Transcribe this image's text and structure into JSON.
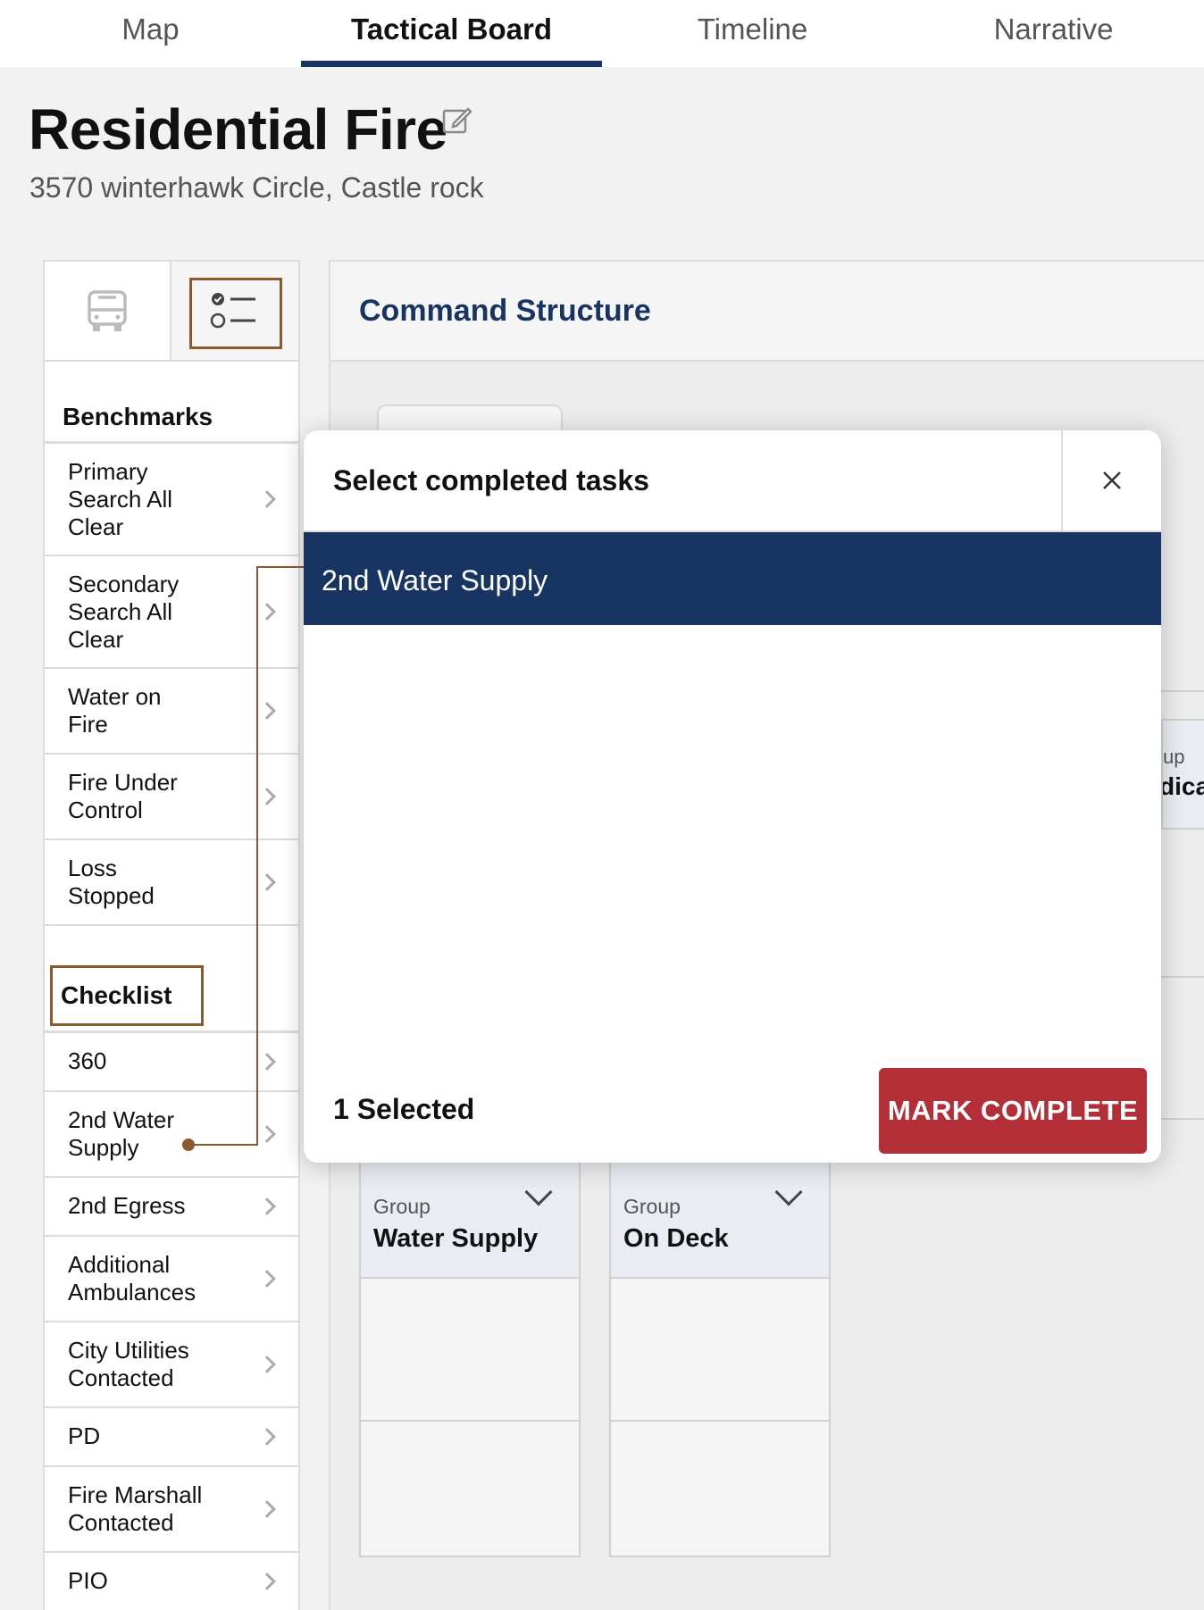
{
  "tabs": [
    {
      "label": "Map"
    },
    {
      "label": "Tactical Board"
    },
    {
      "label": "Timeline"
    },
    {
      "label": "Narrative"
    }
  ],
  "active_tab": "Tactical Board",
  "header": {
    "title": "Residential Fire",
    "address": "3570 winterhawk Circle, Castle rock"
  },
  "sidebar": {
    "benchmarks_title": "Benchmarks",
    "benchmarks": [
      {
        "label": "Primary\nSearch All\nClear"
      },
      {
        "label": "Secondary\nSearch All\nClear"
      },
      {
        "label": "Water on\nFire"
      },
      {
        "label": "Fire Under\nControl"
      },
      {
        "label": "Loss\nStopped"
      }
    ],
    "checklist_title": "Checklist",
    "checklist": [
      {
        "label": "360"
      },
      {
        "label": "2nd Water\nSupply"
      },
      {
        "label": "2nd Egress"
      },
      {
        "label": "Additional\nAmbulances"
      },
      {
        "label": "City Utilities\nContacted"
      },
      {
        "label": "PD"
      },
      {
        "label": "Fire Marshall\nContacted"
      },
      {
        "label": "PIO"
      }
    ]
  },
  "main": {
    "title": "Command Structure",
    "partial_card": {
      "label": "up",
      "name": "dica"
    },
    "groups": [
      {
        "label": "Group",
        "name": "Water Supply"
      },
      {
        "label": "Group",
        "name": "On Deck"
      }
    ]
  },
  "modal": {
    "title": "Select completed tasks",
    "tasks": [
      {
        "label": "2nd Water Supply",
        "selected": true
      }
    ],
    "selected_count": "1 Selected",
    "action_label": "MARK COMPLETE"
  },
  "colors": {
    "navy": "#173462",
    "danger": "#b32e37",
    "highlight": "#8a5a2f"
  }
}
